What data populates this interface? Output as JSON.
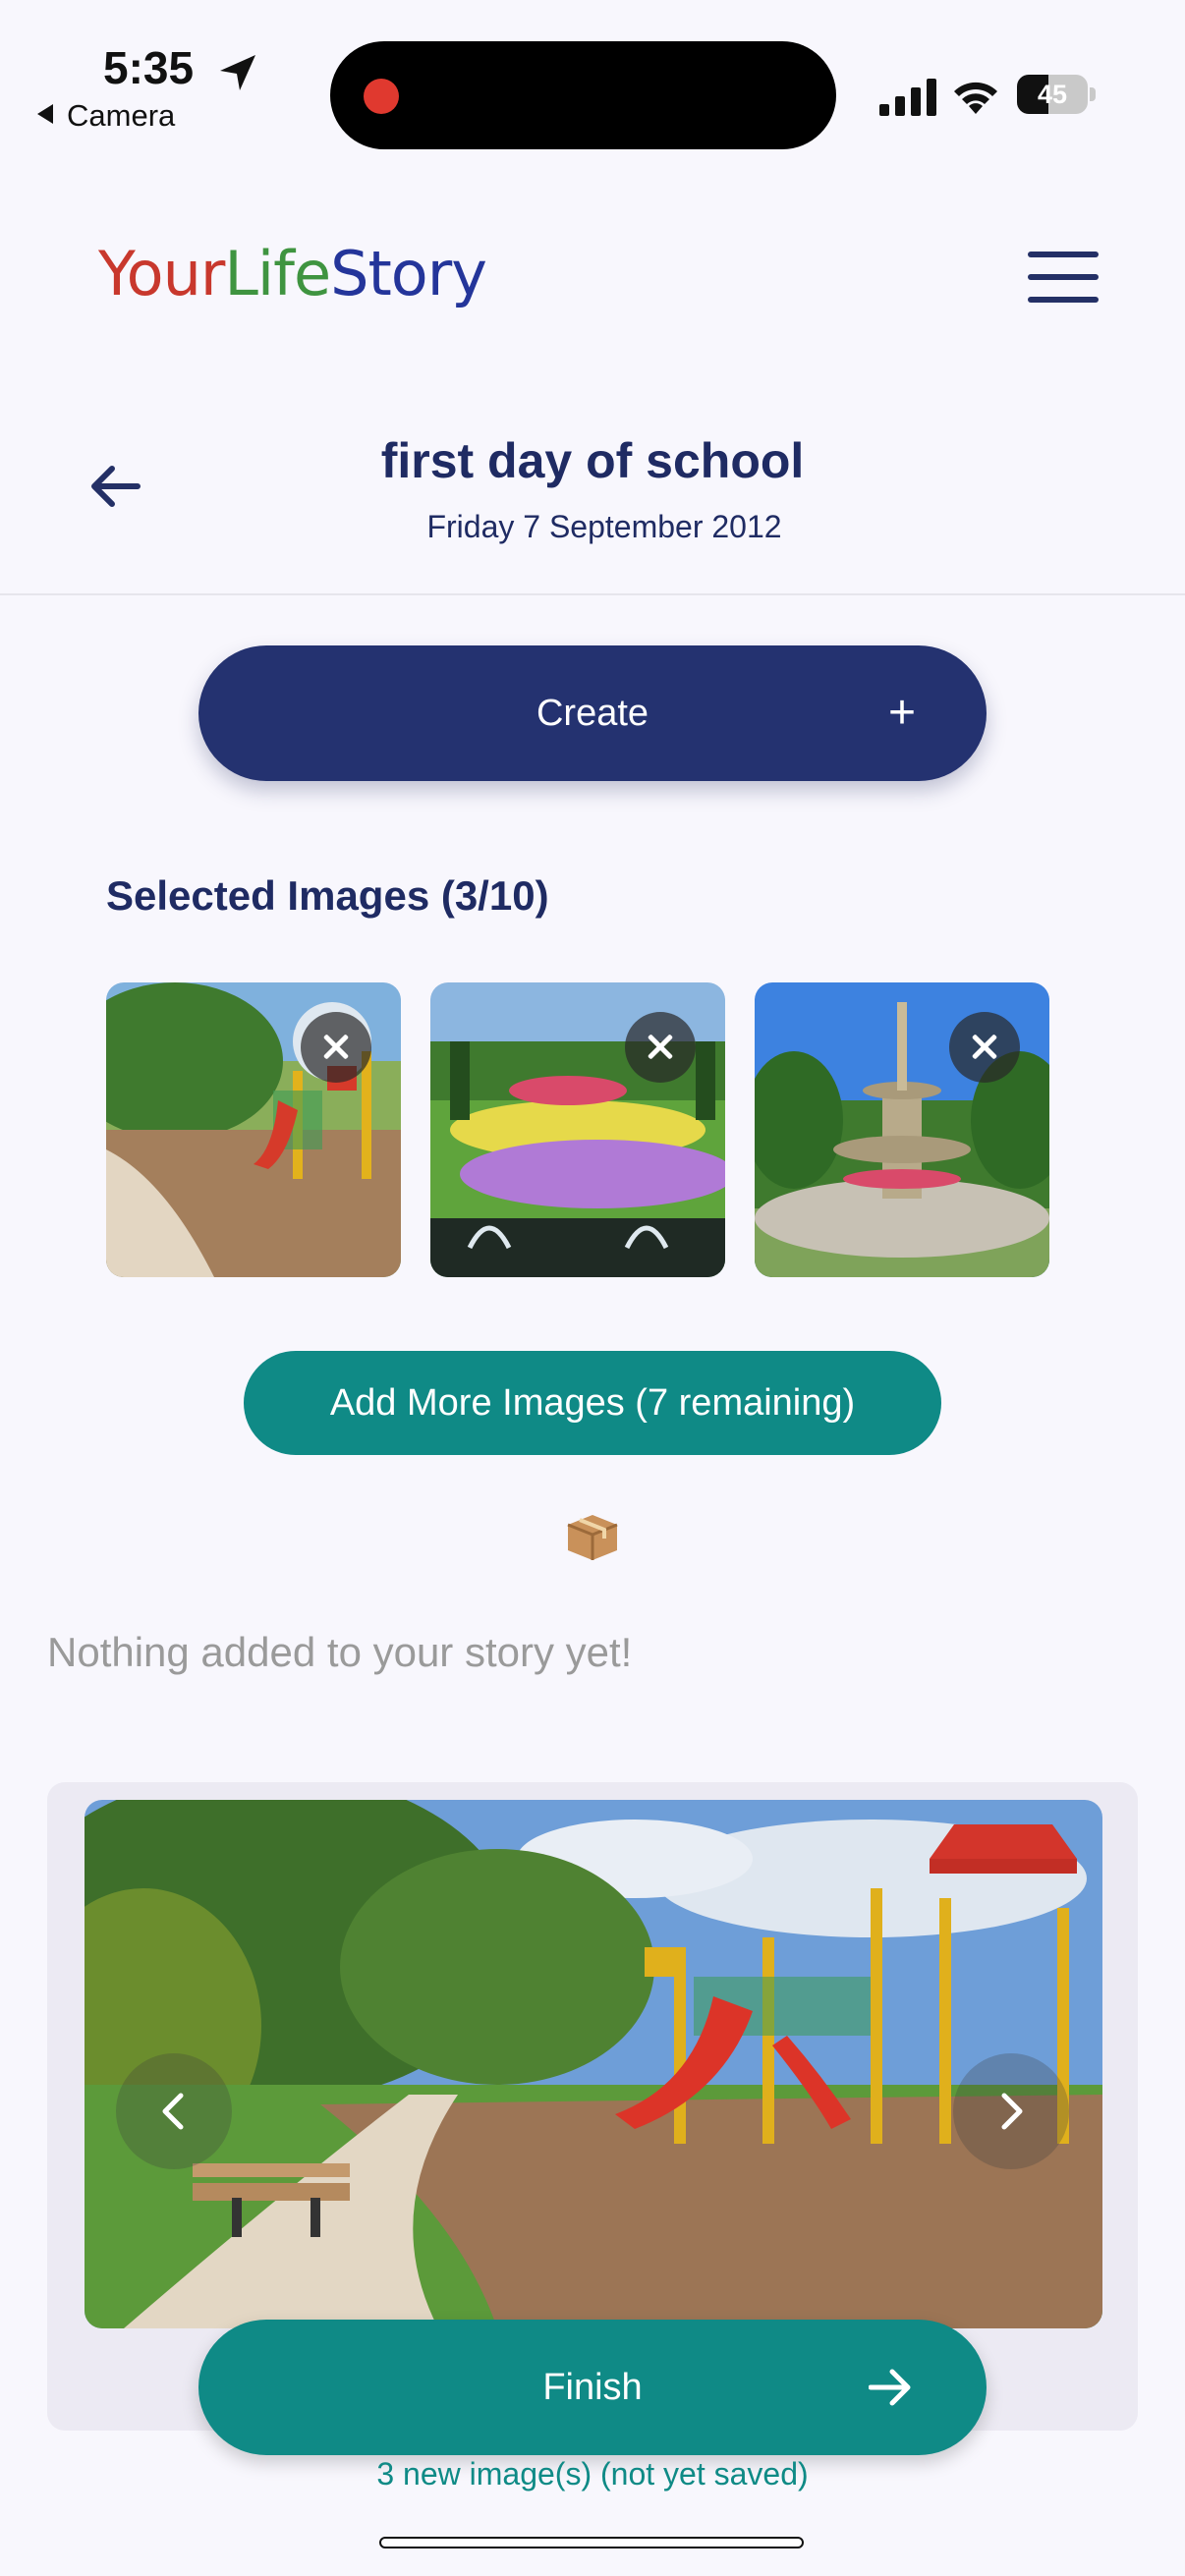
{
  "status_bar": {
    "time": "5:35",
    "back_app": "Camera",
    "battery": "45",
    "battery_level": 0.45
  },
  "header": {
    "logo_part1": "Your",
    "logo_part2": "Life",
    "logo_part3": "Story"
  },
  "story": {
    "title": "first day of school",
    "date": "Friday 7 September 2012"
  },
  "create_button": {
    "label": "Create",
    "icon": "+"
  },
  "selected_images": {
    "title": "Selected Images (3/10)",
    "thumbnails": [
      {
        "name": "playground",
        "remove_icon": "close-icon"
      },
      {
        "name": "flower-garden",
        "remove_icon": "close-icon"
      },
      {
        "name": "fountain",
        "remove_icon": "close-icon"
      }
    ]
  },
  "add_more_button": {
    "label": "Add More Images (7 remaining)"
  },
  "empty_state": {
    "icon": "package-icon",
    "message": "Nothing added to your story yet!"
  },
  "carousel": {
    "prev_icon": "chevron-left-icon",
    "next_icon": "chevron-right-icon"
  },
  "finish_button": {
    "label": "Finish"
  },
  "footer_note": "3 new image(s) (not yet saved)",
  "colors": {
    "navy": "#243270",
    "teal": "#0f8a86",
    "logo_red": "#c8382d",
    "logo_green": "#3f9440",
    "logo_blue": "#24359a",
    "background": "#f8f7fd"
  }
}
